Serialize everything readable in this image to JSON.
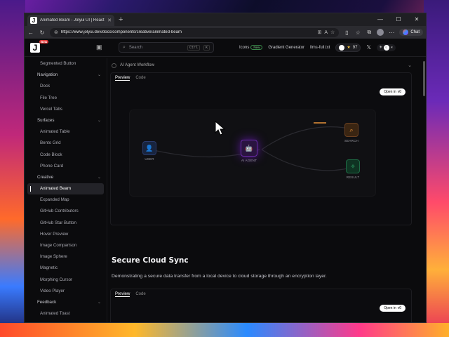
{
  "browser": {
    "tab_title": "Animated Beam - Jolyui UI | React C",
    "url": "https://www.jolyui.dev/docs/components/creative/animated-beam",
    "chat_label": "Chat"
  },
  "header": {
    "logo_letter": "J",
    "logo_badge": "Beta",
    "search_placeholder": "Search",
    "search_kbd_ctrl": "Ctrl",
    "search_kbd_k": "K",
    "links": {
      "icons": "Icons",
      "icons_badge": "New",
      "gradient_generator": "Gradient Generator",
      "llms_full": "llms-full.txt"
    },
    "github_stars": "97"
  },
  "sidebar": {
    "items": [
      {
        "type": "item",
        "label": "Segmented Button"
      },
      {
        "type": "section",
        "label": "Navigation"
      },
      {
        "type": "item",
        "label": "Dock"
      },
      {
        "type": "item",
        "label": "File Tree"
      },
      {
        "type": "item",
        "label": "Vercel Tabs"
      },
      {
        "type": "section",
        "label": "Surfaces"
      },
      {
        "type": "item",
        "label": "Animated Table"
      },
      {
        "type": "item",
        "label": "Bento Grid"
      },
      {
        "type": "item",
        "label": "Code Block"
      },
      {
        "type": "item",
        "label": "Phone Card"
      },
      {
        "type": "section",
        "label": "Creative"
      },
      {
        "type": "item",
        "label": "Animated Beam",
        "active": true
      },
      {
        "type": "item",
        "label": "Expanded Map"
      },
      {
        "type": "item",
        "label": "GitHub Contributors"
      },
      {
        "type": "item",
        "label": "GitHub Star Button"
      },
      {
        "type": "item",
        "label": "Hover Preview"
      },
      {
        "type": "item",
        "label": "Image Comparison"
      },
      {
        "type": "item",
        "label": "Image Sphere"
      },
      {
        "type": "item",
        "label": "Magnetic"
      },
      {
        "type": "item",
        "label": "Morphing Cursor"
      },
      {
        "type": "item",
        "label": "Video Player"
      },
      {
        "type": "section",
        "label": "Feedback"
      },
      {
        "type": "item",
        "label": "Animated Toast"
      },
      {
        "type": "item",
        "label": "Animated Tooltip"
      }
    ]
  },
  "main": {
    "accordion_title": "AI Agent Workflow",
    "tabs": {
      "preview": "Preview",
      "code": "Code"
    },
    "open_in": "Open in",
    "beam_nodes": {
      "user": "USER",
      "agent": "AI AGENT",
      "search": "SEARCH",
      "result": "RESULT"
    },
    "section2_title": "Secure Cloud Sync",
    "section2_desc": "Demonstrating a secure data transfer from a local device to cloud storage through an encryption layer."
  },
  "colors": {
    "agent_purple": "#8a3ad0",
    "user_blue": "#3a6ad0",
    "search_orange": "#e8923a",
    "result_green": "#3ac07a"
  }
}
